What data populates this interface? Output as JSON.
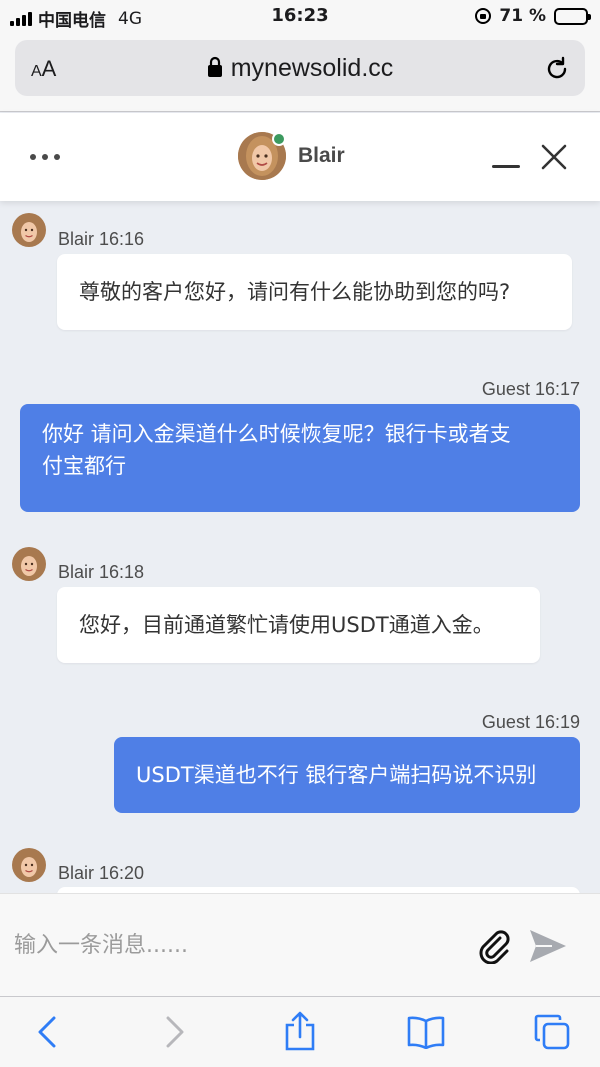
{
  "status_bar": {
    "carrier": "中国电信",
    "network": "4G",
    "time": "16:23",
    "battery": "71 %",
    "battery_level": 0.71
  },
  "browser": {
    "text_size_label": "AA",
    "url": "mynewsolid.cc",
    "icons": [
      "lock-icon",
      "reload-icon"
    ]
  },
  "chat_header": {
    "agent_name": "Blair",
    "status": "online",
    "status_color": "#3c9a5f",
    "icons": [
      "more-icon",
      "minimize-icon",
      "close-icon"
    ]
  },
  "messages": [
    {
      "sender": "Blair",
      "role": "agent",
      "time": "16:16",
      "meta": "Blair 16:16",
      "lines": [
        "尊敬的客户您好，请问有什么能协助到您的吗?"
      ]
    },
    {
      "sender": "Guest",
      "role": "guest",
      "time": "16:17",
      "meta": "Guest 16:17",
      "lines": [
        "你好 请问入金渠道什么时候恢复呢？银行卡或者支",
        "付宝都行"
      ]
    },
    {
      "sender": "Blair",
      "role": "agent",
      "time": "16:18",
      "meta": "Blair 16:18",
      "lines": [
        "您好，目前通道繁忙请使用USDT通道入金。"
      ]
    },
    {
      "sender": "Guest",
      "role": "guest",
      "time": "16:19",
      "meta": "Guest 16:19",
      "lines": [
        "USDT渠道也不行 银行客户端扫码说不识别"
      ]
    },
    {
      "sender": "Blair",
      "role": "agent",
      "time": "16:20",
      "meta": "Blair 16:20",
      "lines": []
    }
  ],
  "composer": {
    "placeholder": "输入一条消息......",
    "icons": [
      "paperclip-icon",
      "send-icon"
    ]
  },
  "toolbar": {
    "icons": [
      "back-icon",
      "forward-icon",
      "share-icon",
      "bookmarks-icon",
      "tabs-icon"
    ]
  },
  "colors": {
    "guest_bubble": "#4f7fe6",
    "agent_bubble": "#ffffff",
    "chat_background": "#ebeef3",
    "accent": "#2f7df6"
  }
}
